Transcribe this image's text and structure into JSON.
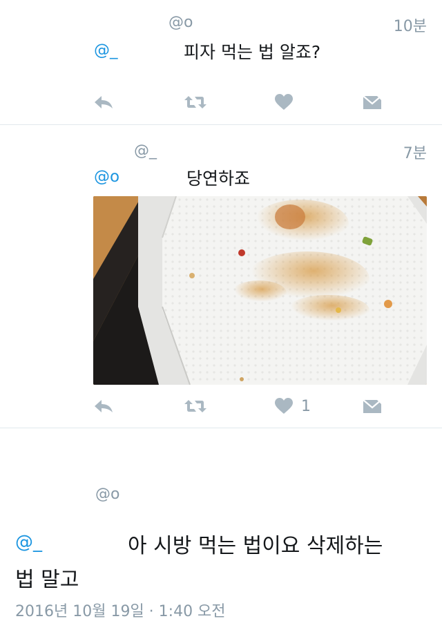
{
  "tweets": [
    {
      "handle": "@o",
      "time": "10분",
      "reply_to": "@_",
      "text": "피자 먹는 법 알죠?",
      "like_count": ""
    },
    {
      "handle": "@_",
      "time": "7분",
      "reply_to": "@o",
      "text": "당연하죠",
      "like_count": "1",
      "has_media": true
    }
  ],
  "main_tweet": {
    "handle": "@o",
    "reply_to": "@_",
    "text_line1": "아 시방 먹는 법이요 삭제하는",
    "text_line2": "법 말고",
    "timestamp": "2016년 10월 19일 · 1:40 오전"
  },
  "colors": {
    "link_blue": "#1b95e0",
    "muted_gray": "#8899a6",
    "icon_gray": "#aab8c2",
    "divider": "#e1e8ed"
  },
  "icons": [
    "reply-icon",
    "retweet-icon",
    "like-icon",
    "message-icon"
  ]
}
